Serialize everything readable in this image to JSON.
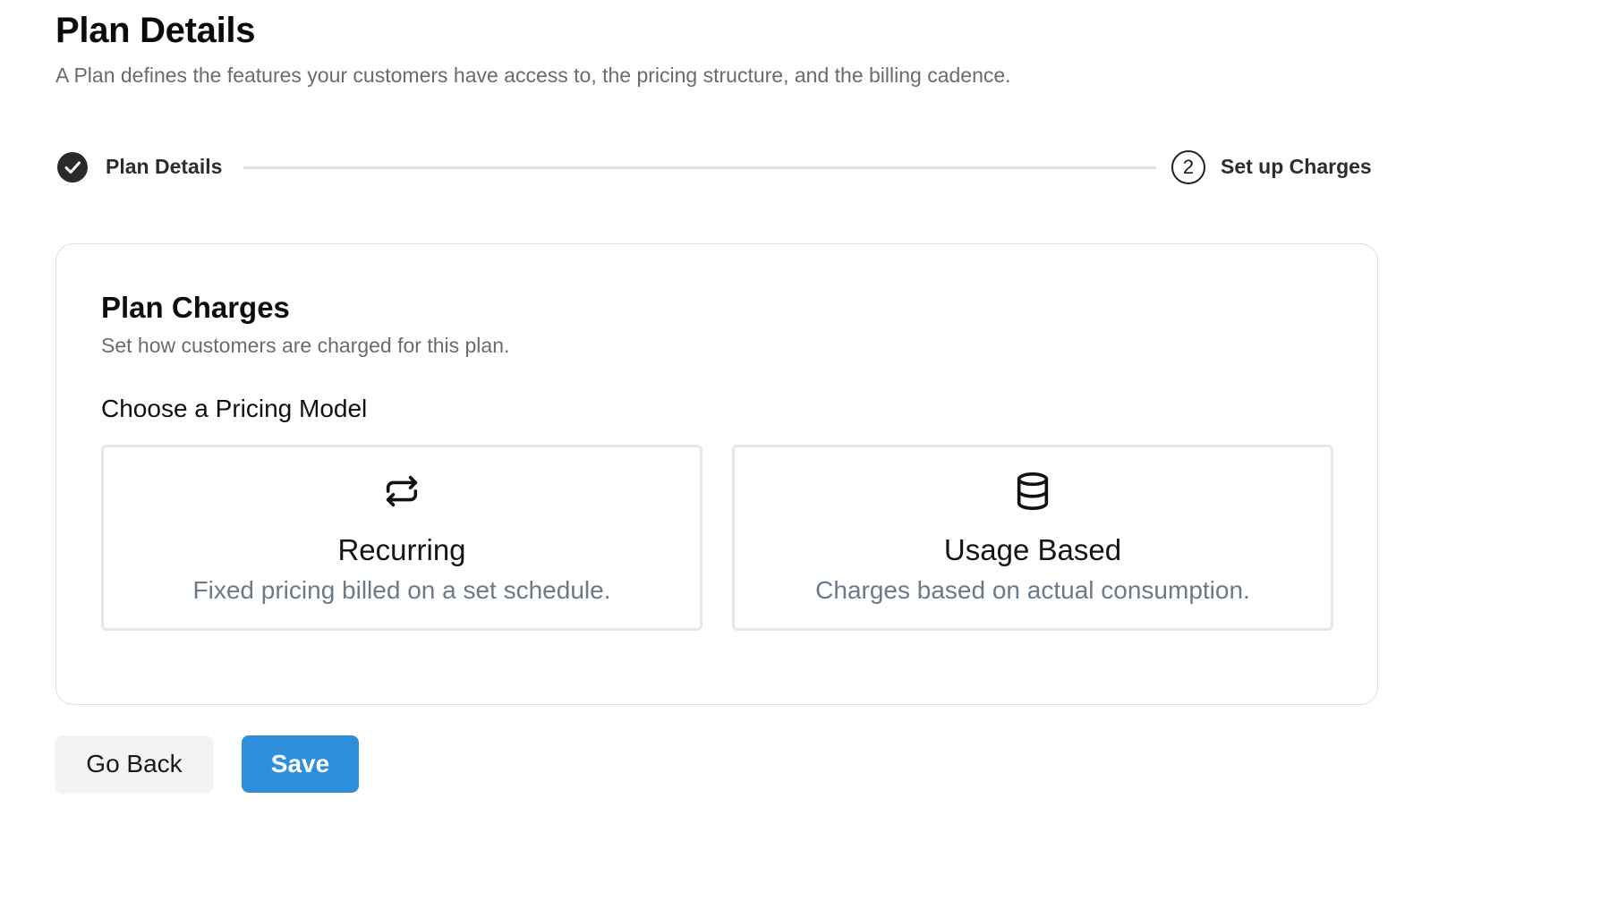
{
  "page": {
    "title": "Plan Details",
    "subtitle": "A Plan defines the features your customers have access to, the pricing structure, and the billing cadence."
  },
  "stepper": {
    "steps": [
      {
        "label": "Plan Details",
        "status": "completed",
        "icon": "check-circle-icon"
      },
      {
        "label": "Set up Charges",
        "status": "current",
        "number": "2"
      }
    ]
  },
  "charges": {
    "title": "Plan Charges",
    "subtitle": "Set how customers are charged for this plan.",
    "pricing_model_label": "Choose a Pricing Model",
    "options": [
      {
        "icon": "repeat-icon",
        "title": "Recurring",
        "description": "Fixed pricing billed on a set schedule."
      },
      {
        "icon": "database-icon",
        "title": "Usage Based",
        "description": "Charges based on actual consumption."
      }
    ]
  },
  "actions": {
    "back_label": "Go Back",
    "save_label": "Save"
  },
  "colors": {
    "primary": "#2f8fdc",
    "secondary_button_bg": "#f3f3f3",
    "muted_text": "#6b6b6b",
    "option_desc_text": "#6b7a8b",
    "border": "#dedede"
  }
}
